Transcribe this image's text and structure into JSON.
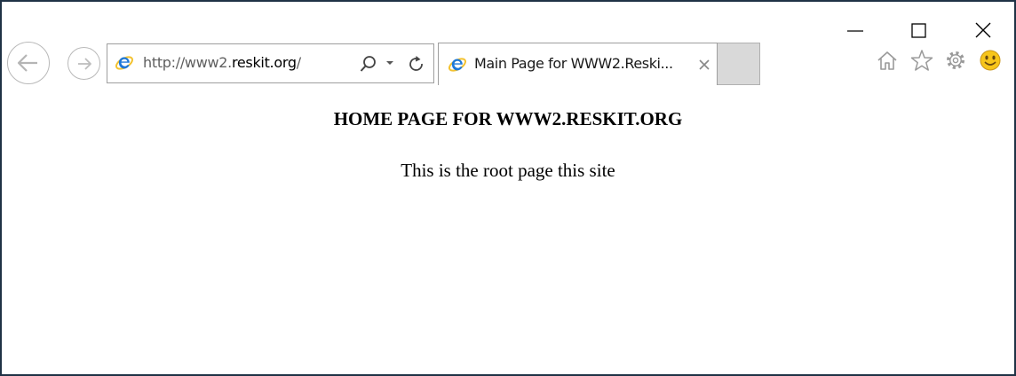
{
  "colors": {
    "frame_border": "#1f3245",
    "inactive_tab": "#d9d9d9",
    "ie_blue": "#1e78d8",
    "ie_ring": "#f3c230",
    "smiley": "#f7c51b"
  },
  "toolbar": {
    "back_icon": "back-arrow-icon",
    "forward_icon": "forward-arrow-icon",
    "address": {
      "scheme": "http://www2.",
      "host": "reskit.org",
      "path": "/"
    },
    "search_icon": "search-icon",
    "dropdown_icon": "chevron-down-icon",
    "refresh_icon": "refresh-icon"
  },
  "tab": {
    "title": "Main Page for WWW2.Reski...",
    "close_icon": "close-icon",
    "favicon": "ie-icon"
  },
  "window_controls": [
    "minimize-icon",
    "maximize-icon",
    "close-icon"
  ],
  "tools": [
    "home-icon",
    "star-icon",
    "gear-icon",
    "smiley-icon"
  ],
  "page": {
    "heading": "HOME PAGE FOR WWW2.RESKIT.ORG",
    "body": "This is the root page this site"
  }
}
